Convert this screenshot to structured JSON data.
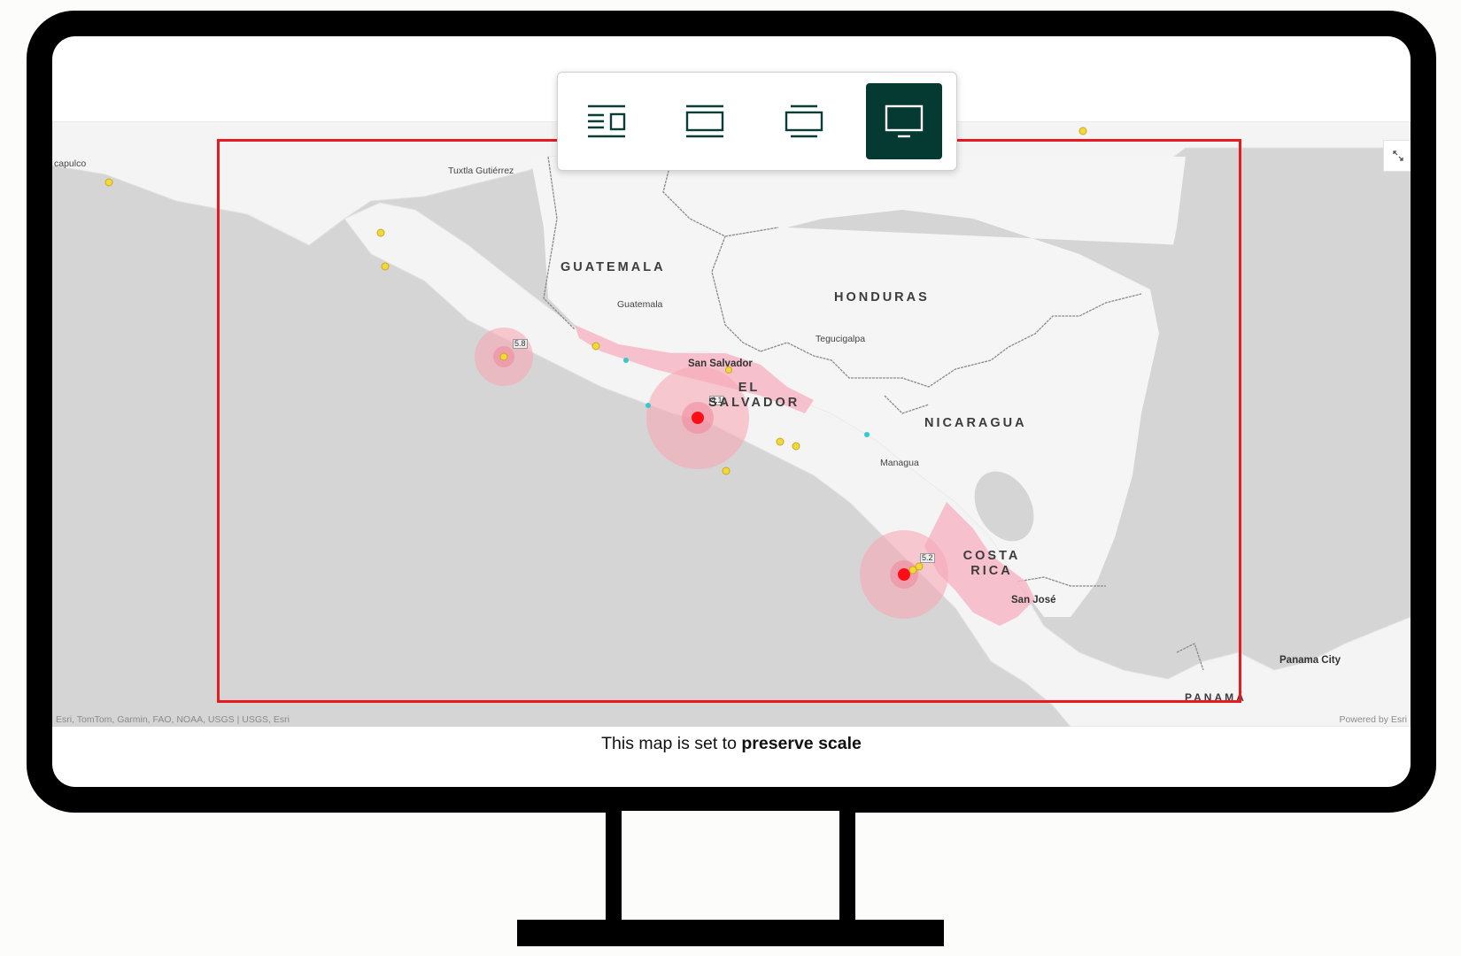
{
  "toolbar": {
    "buttons": [
      {
        "name": "layout-sidebar",
        "icon": "sidebar-layout-icon",
        "active": false
      },
      {
        "name": "layout-banner",
        "icon": "banner-layout-icon",
        "active": false
      },
      {
        "name": "layout-wide",
        "icon": "wide-layout-icon",
        "active": false
      },
      {
        "name": "layout-desktop",
        "icon": "desktop-icon",
        "active": true
      }
    ],
    "active_color": "#053a33"
  },
  "map": {
    "countries": [
      {
        "id": "guatemala",
        "lines": [
          "GUATEMALA"
        ]
      },
      {
        "id": "honduras",
        "lines": [
          "HONDURAS"
        ]
      },
      {
        "id": "el-salvador",
        "lines": [
          "EL",
          "SALVADOR"
        ]
      },
      {
        "id": "nicaragua",
        "lines": [
          "NICARAGUA"
        ]
      },
      {
        "id": "costa-rica",
        "lines": [
          "COSTA",
          "RICA"
        ]
      },
      {
        "id": "panama",
        "lines": [
          "PANAMÁ"
        ]
      }
    ],
    "cities": {
      "acapulco": "capulco",
      "tuxtla": "Tuxtla Gutiérrez",
      "guatemala": "Guatemala",
      "tegucigalpa": "Tegucigalpa",
      "san_salvador": "San Salvador",
      "managua": "Managua",
      "san_jose": "San José",
      "panama_city": "Panama City"
    },
    "quake_labels": {
      "q1": "5.8",
      "q2": "4.1",
      "q3": "5.2"
    },
    "attribution_left": "Esri, TomTom, Garmin, FAO, NOAA, USGS | USGS, Esri",
    "attribution_right": "Powered by Esri",
    "extent_color": "#e8191f",
    "fullscreen_icon": "expand-icon"
  },
  "caption": {
    "prefix": "This map is set to ",
    "emphasis": "preserve scale"
  }
}
